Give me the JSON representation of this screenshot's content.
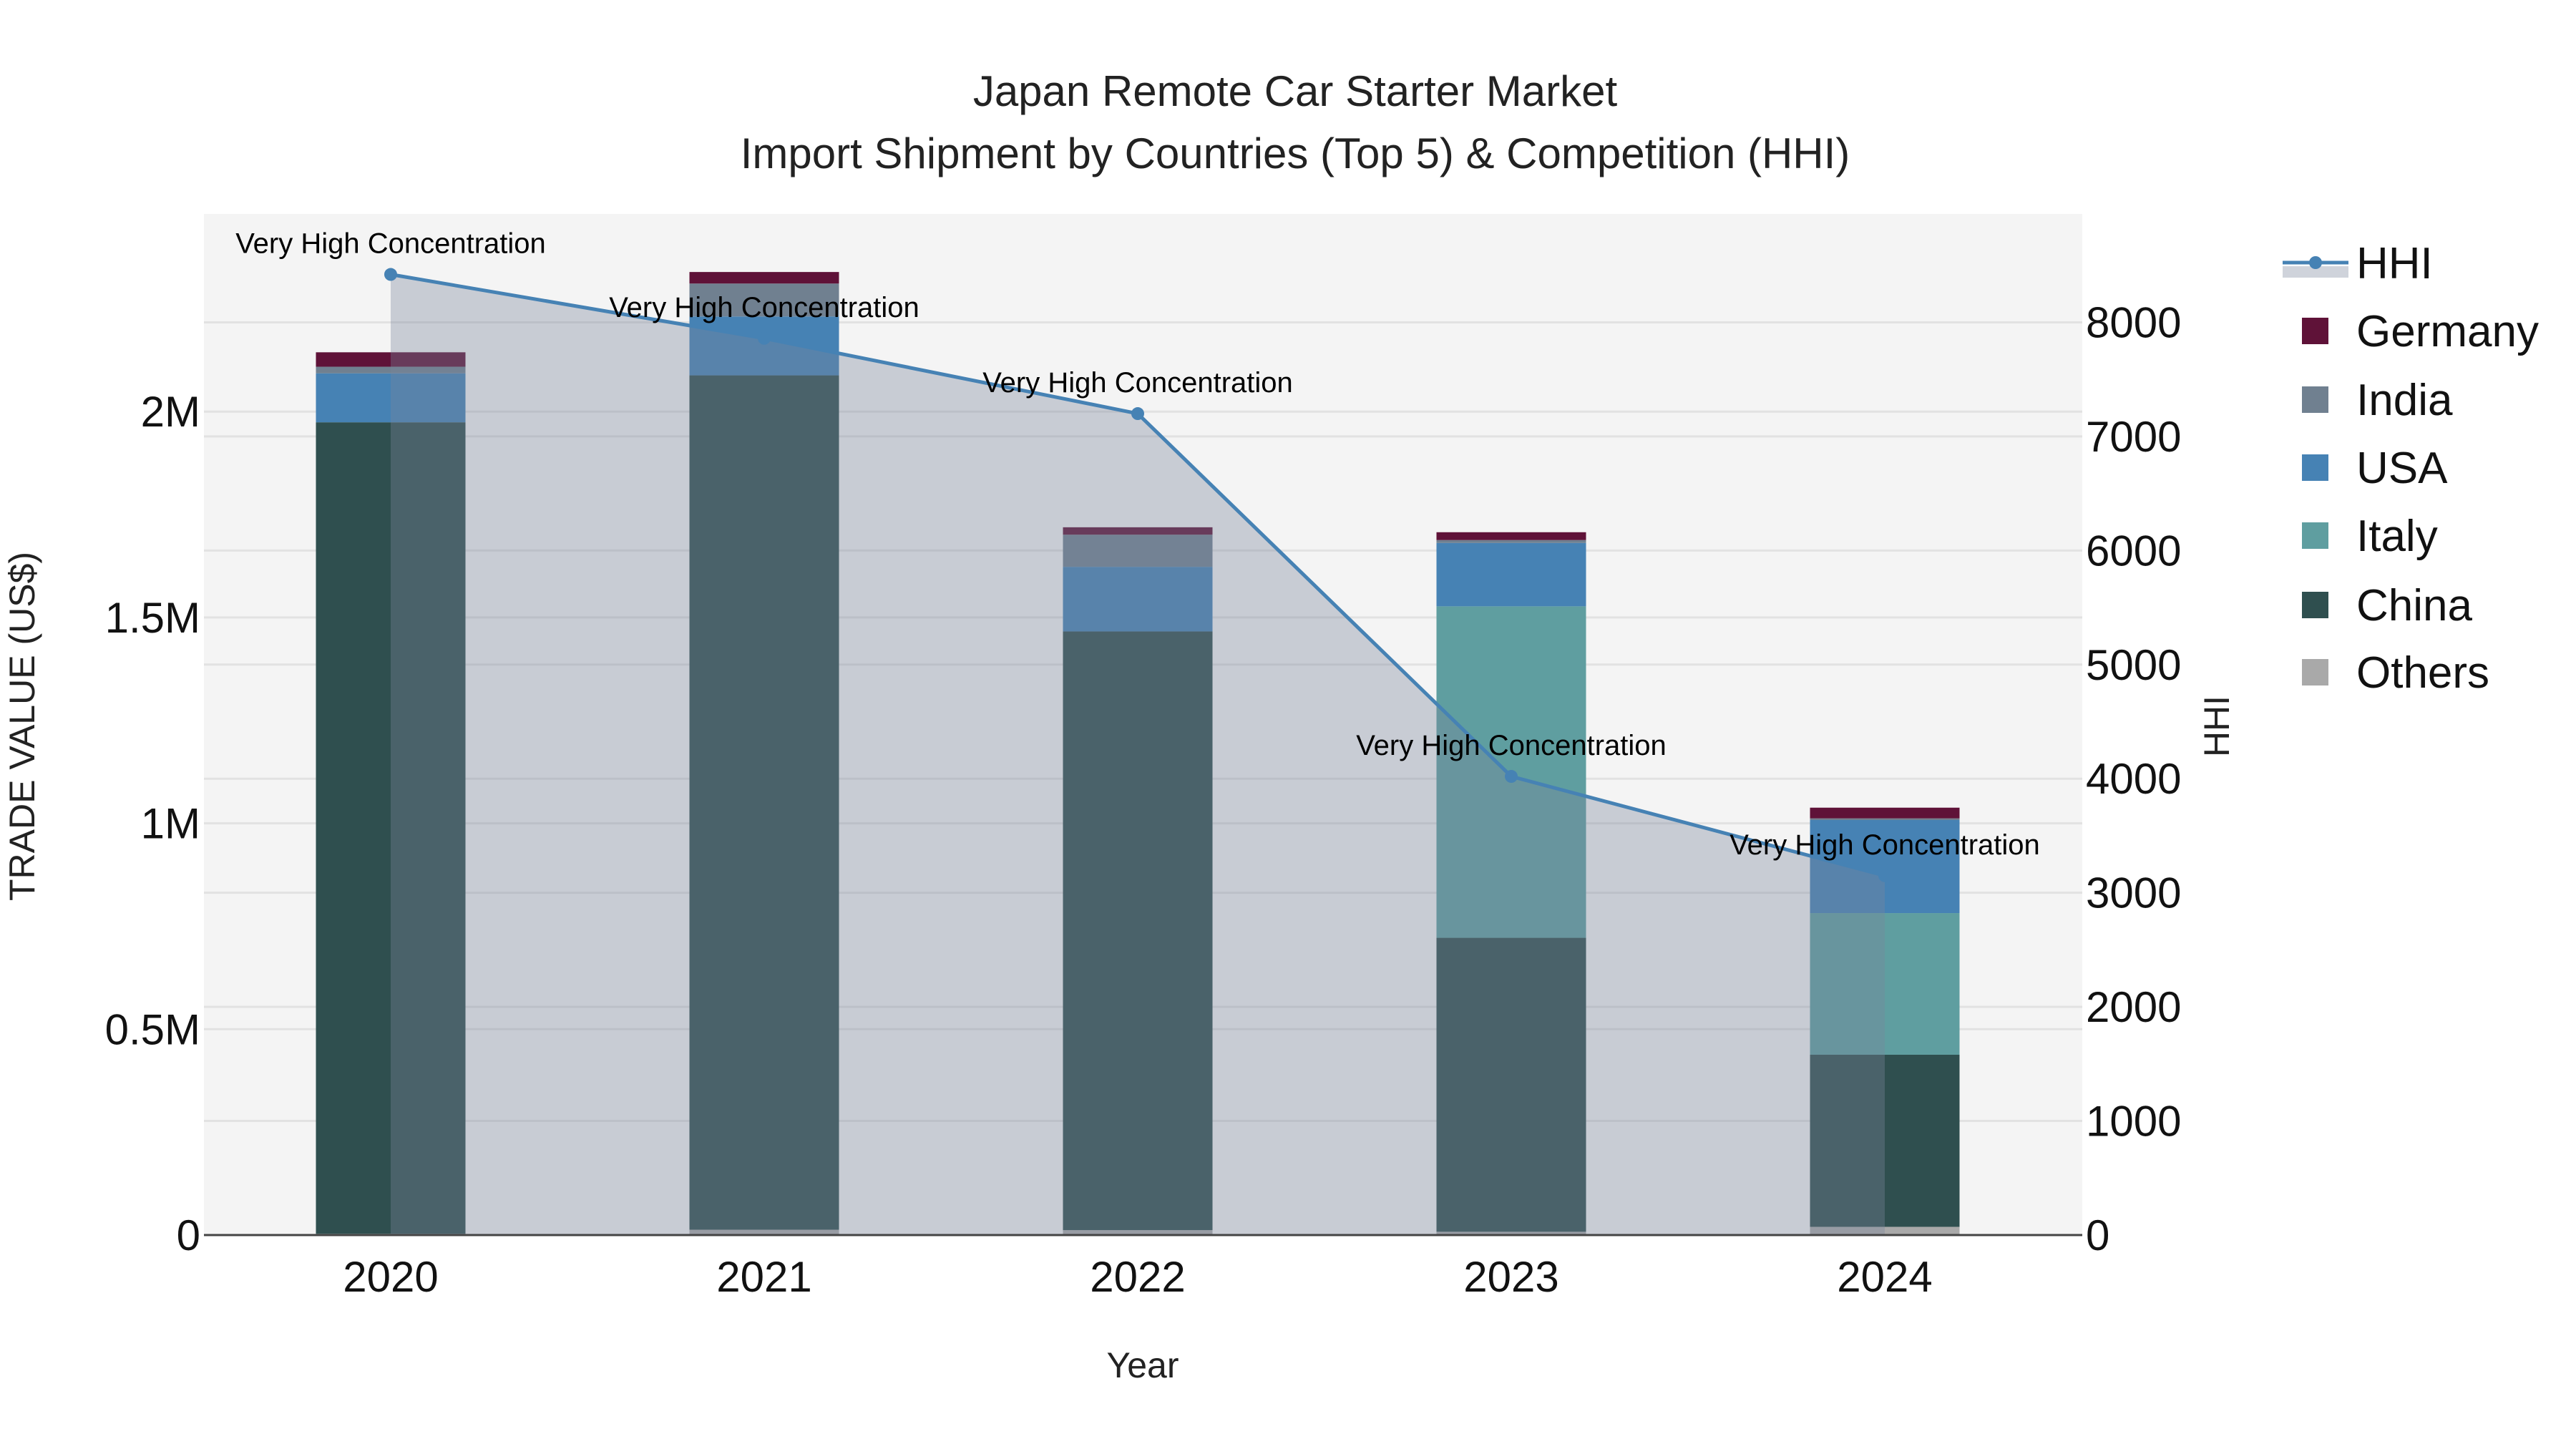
{
  "chart_data": {
    "type": "bar",
    "title_line1": "Japan Remote Car Starter Market",
    "title_line2": "Import Shipment by Countries (Top 5) & Competition (HHI)",
    "xlabel": "Year",
    "ylabel": "TRADE VALUE (US$)",
    "y2label": "HHI",
    "categories": [
      "2020",
      "2021",
      "2022",
      "2023",
      "2024"
    ],
    "ylim": [
      0,
      2480000
    ],
    "y2lim": [
      0,
      8950
    ],
    "yticks": [
      {
        "v": 0,
        "label": "0"
      },
      {
        "v": 500000,
        "label": "0.5M"
      },
      {
        "v": 1000000,
        "label": "1M"
      },
      {
        "v": 1500000,
        "label": "1.5M"
      },
      {
        "v": 2000000,
        "label": "2M"
      }
    ],
    "y2ticks": [
      {
        "v": 0,
        "label": "0"
      },
      {
        "v": 1000,
        "label": "1000"
      },
      {
        "v": 2000,
        "label": "2000"
      },
      {
        "v": 3000,
        "label": "3000"
      },
      {
        "v": 4000,
        "label": "4000"
      },
      {
        "v": 5000,
        "label": "5000"
      },
      {
        "v": 6000,
        "label": "6000"
      },
      {
        "v": 7000,
        "label": "7000"
      },
      {
        "v": 8000,
        "label": "8000"
      }
    ],
    "stacked_series": [
      {
        "name": "Others",
        "color": "#a9a9a9",
        "values": [
          3000,
          13000,
          12000,
          8000,
          20000
        ]
      },
      {
        "name": "China",
        "color": "#2f4f4f",
        "values": [
          1971000,
          2075000,
          1454000,
          714000,
          418000
        ]
      },
      {
        "name": "Italy",
        "color": "#5f9ea0",
        "values": [
          0,
          0,
          0,
          805000,
          344000
        ]
      },
      {
        "name": "USA",
        "color": "#4682b4",
        "values": [
          119000,
          143000,
          157000,
          154000,
          226000
        ]
      },
      {
        "name": "India",
        "color": "#708090",
        "values": [
          16000,
          80000,
          78000,
          7000,
          4000
        ]
      },
      {
        "name": "Germany",
        "color": "#5f1238",
        "values": [
          35000,
          28000,
          18000,
          19000,
          26000
        ]
      }
    ],
    "line_series": {
      "name": "HHI",
      "color": "#4682b4",
      "values": [
        8420,
        7860,
        7200,
        4020,
        3150
      ]
    },
    "annotations": [
      "Very High Concentration",
      "Very High Concentration",
      "Very High Concentration",
      "Very High Concentration",
      "Very High Concentration"
    ],
    "legend": [
      "HHI",
      "Germany",
      "India",
      "USA",
      "Italy",
      "China",
      "Others"
    ],
    "legend_position": "right",
    "grid": true
  }
}
